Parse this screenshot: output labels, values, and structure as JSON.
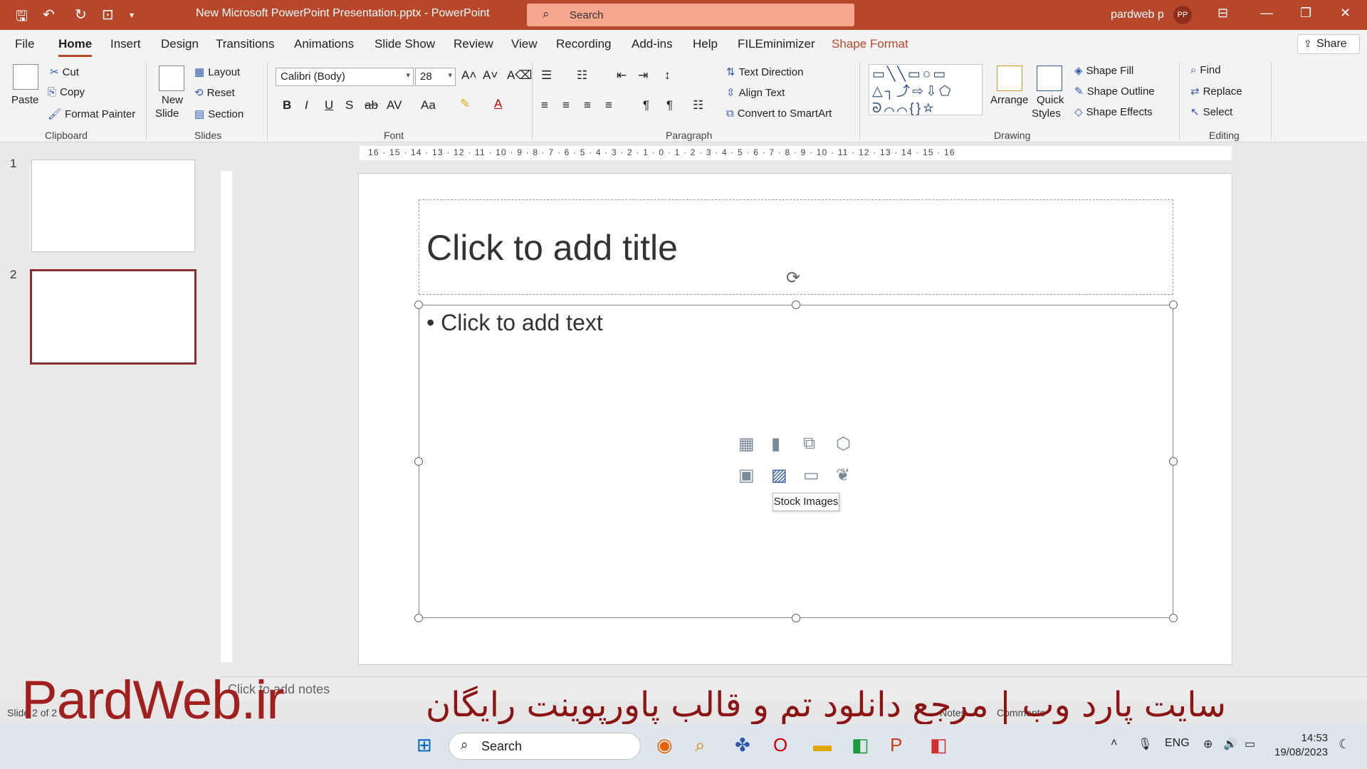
{
  "window": {
    "doc_title": "New Microsoft PowerPoint Presentation.pptx  -  PowerPoint",
    "search_placeholder": "Search",
    "user_name": "pardweb p",
    "user_initials": "PP"
  },
  "tabs": [
    "File",
    "Home",
    "Insert",
    "Design",
    "Transitions",
    "Animations",
    "Slide Show",
    "Review",
    "View",
    "Recording",
    "Add-ins",
    "Help",
    "FILEminimizer",
    "Shape Format"
  ],
  "share_label": "Share",
  "ribbon": {
    "clipboard": {
      "paste": "Paste",
      "cut": "Cut",
      "copy": "Copy",
      "format_painter": "Format Painter",
      "label": "Clipboard"
    },
    "slides": {
      "new_slide_1": "New",
      "new_slide_2": "Slide",
      "layout": "Layout",
      "reset": "Reset",
      "section": "Section",
      "label": "Slides"
    },
    "font": {
      "family": "Calibri (Body)",
      "size": "28",
      "label": "Font"
    },
    "paragraph": {
      "text_direction": "Text Direction",
      "align_text": "Align Text",
      "convert_smartart": "Convert to SmartArt",
      "label": "Paragraph"
    },
    "drawing": {
      "arrange": "Arrange",
      "quick_1": "Quick",
      "quick_2": "Styles",
      "shape_fill": "Shape Fill",
      "shape_outline": "Shape Outline",
      "shape_effects": "Shape Effects",
      "label": "Drawing"
    },
    "editing": {
      "find": "Find",
      "replace": "Replace",
      "select": "Select",
      "label": "Editing"
    }
  },
  "ruler_labels": "16 · 15 · 14 · 13 · 12 · 11 · 10 · 9 · 8 · 7 · 6 · 5 · 4 · 3 · 2 · 1 · 0 · 1 · 2 · 3 · 4 · 5 · 6 · 7 · 8 · 9 · 10 · 11 · 12 · 13 · 14 · 15 · 16",
  "thumbnails": [
    "1",
    "2"
  ],
  "slide": {
    "title_placeholder": "Click to add title",
    "content_placeholder": "• Click to add text",
    "tooltip": "Stock Images"
  },
  "notes_placeholder": "Click to add notes",
  "status": {
    "slide_of": "Slide 2 of 2",
    "notes": "Notes",
    "comments": "Comments"
  },
  "watermark": {
    "logo": "PardWeb.ir",
    "tagline": "سایت پارد وب | مرجع دانلود تم و قالب پاورپوینت رایگان"
  },
  "taskbar": {
    "search": "Search",
    "lang": "ENG",
    "time": "14:53",
    "date": "19/08/2023"
  }
}
